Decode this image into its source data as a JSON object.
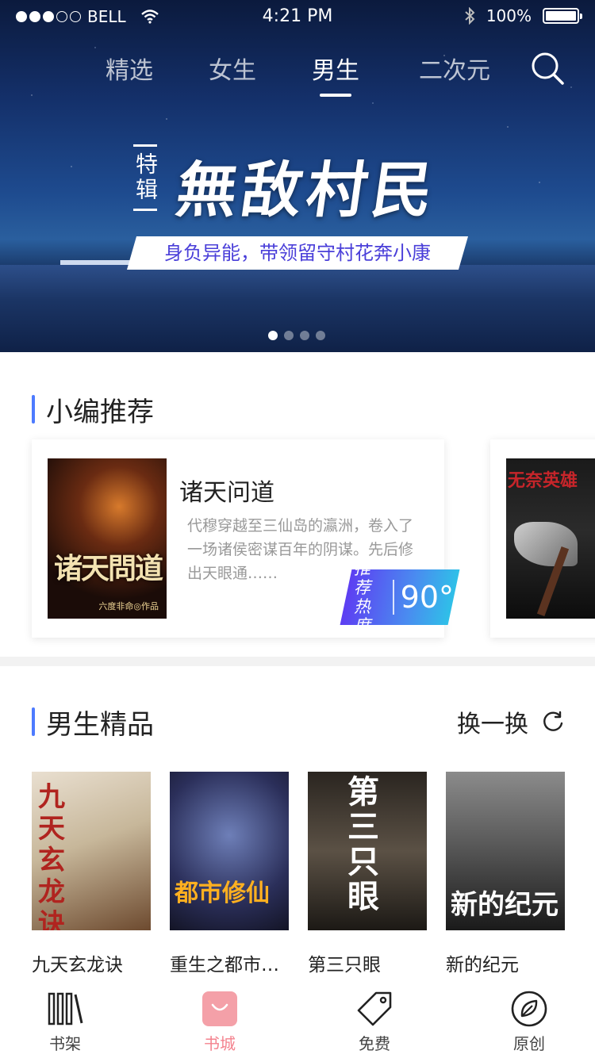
{
  "status_bar": {
    "carrier": "BELL",
    "time": "4:21 PM",
    "battery": "100%",
    "signal_bars": 3
  },
  "tabs": [
    {
      "label": "精选",
      "active": false
    },
    {
      "label": "女生",
      "active": false
    },
    {
      "label": "男生",
      "active": true
    },
    {
      "label": "二次元",
      "active": false
    }
  ],
  "banner": {
    "tag": "特辑",
    "title": "無敌村民",
    "subtitle": "身负异能，带领留守村花奔小康",
    "page_count": 4,
    "current_page": 1
  },
  "editor_picks": {
    "title": "小编推荐",
    "card": {
      "name": "诸天问道",
      "description": "代穆穿越至三仙岛的瀛洲，卷入了一场诸侯密谋百年的阴谋。先后修出天眼通……",
      "cover_title": "诸天問道",
      "cover_author": "六度非命◎作品",
      "heat_label": "推荐热度",
      "heat_value": "90°"
    },
    "next_card_cover_title": "无奈英雄"
  },
  "male_picks": {
    "title": "男生精品",
    "swap_label": "换一换",
    "books": [
      {
        "title": "九天玄龙诀",
        "cover_text": "九天玄龙诀"
      },
      {
        "title": "重生之都市修仙",
        "cover_text": "都市修仙"
      },
      {
        "title": "第三只眼",
        "cover_text": "第三只眼"
      },
      {
        "title": "新的纪元",
        "cover_text": "新的纪元"
      }
    ]
  },
  "bottom_nav": [
    {
      "label": "书架",
      "icon": "bookshelf-icon",
      "active": false
    },
    {
      "label": "书城",
      "icon": "bag-icon",
      "active": true
    },
    {
      "label": "免费",
      "icon": "tag-icon",
      "active": false
    },
    {
      "label": "原创",
      "icon": "leaf-icon",
      "active": false
    }
  ],
  "colors": {
    "accent_blue": "#4d7bff",
    "nav_active": "#f4828e",
    "banner_subtitle": "#4a3fd9"
  }
}
